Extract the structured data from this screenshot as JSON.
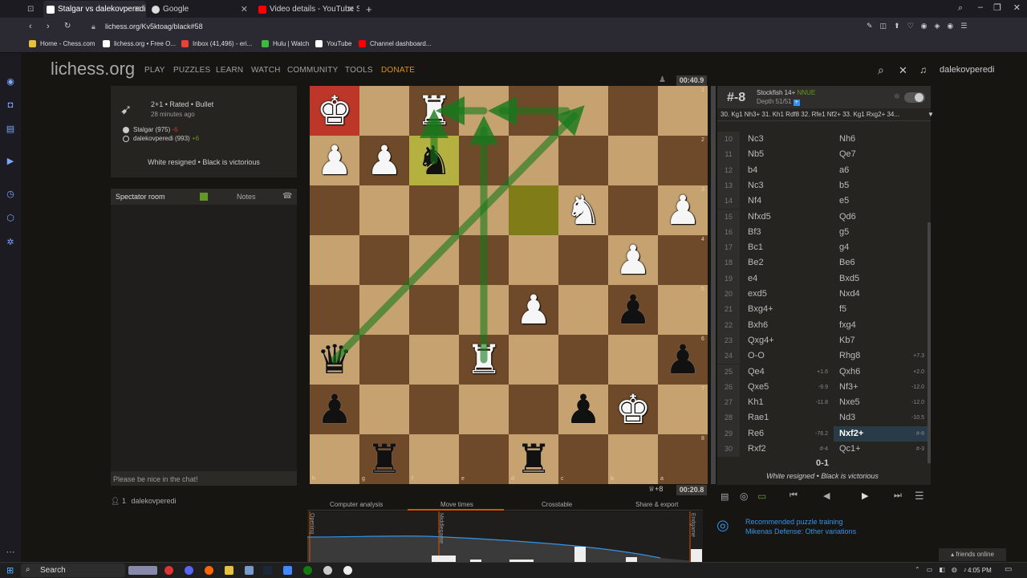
{
  "browser": {
    "tabs": [
      {
        "label": "Stalgar vs dalekovperedi: M",
        "active": true
      },
      {
        "label": "Google",
        "active": false
      },
      {
        "label": "Video details - YouTube Stu",
        "active": false
      }
    ],
    "new_tab": "+",
    "url": "lichess.org/Kv5ktoag/black#58",
    "bookmarks": [
      "Home - Chess.com",
      "lichess.org • Free O...",
      "Inbox (41,496) - eri...",
      "Hulu | Watch",
      "YouTube",
      "Channel dashboard..."
    ]
  },
  "lichess": {
    "logo": "lichess.org",
    "nav": [
      "PLAY",
      "PUZZLES",
      "LEARN",
      "WATCH",
      "COMMUNITY",
      "TOOLS",
      "DONATE"
    ],
    "username": "dalekovperedi"
  },
  "game": {
    "type": "2+1 • Rated • Bullet",
    "when": "28 minutes ago",
    "white_player": "Stalgar (975)",
    "white_diff": "-6",
    "black_player": "dalekovperedi (993)",
    "black_diff": "+6",
    "result": "White resigned • Black is victorious"
  },
  "chat": {
    "tab_room": "Spectator room",
    "tab_notes": "Notes",
    "placeholder": "Please be nice in the chat!",
    "spectators": "1",
    "spectator_name": "dalekovperedi"
  },
  "clocks": {
    "top": "00:40.9",
    "bottom": "00:20.8",
    "bottom_material": "+8"
  },
  "board": {
    "files_bottom": [
      "h",
      "g",
      "f",
      "e",
      "d",
      "c",
      "b",
      "a"
    ],
    "ranks_right": [
      "1",
      "2",
      "3",
      "4",
      "5",
      "6",
      "7",
      "8"
    ]
  },
  "engine": {
    "eval": "#-8",
    "name": "Stockfish 14+",
    "tag": "NNUE",
    "depth": "Depth 51/51",
    "pv": "30. Kg1 Nh3+ 31. Kh1 Rdf8 32. Rfe1 Nf2+ 33. Kg1 Rxg2+ 34..."
  },
  "moves": [
    {
      "n": "10",
      "w": "Nc3",
      "b": "Nh6",
      "ew": "",
      "eb": ""
    },
    {
      "n": "11",
      "w": "Nb5",
      "b": "Qe7",
      "ew": "",
      "eb": ""
    },
    {
      "n": "12",
      "w": "b4",
      "b": "a6",
      "ew": "",
      "eb": ""
    },
    {
      "n": "13",
      "w": "Nc3",
      "b": "b5",
      "ew": "",
      "eb": ""
    },
    {
      "n": "14",
      "w": "Nf4",
      "b": "e5",
      "ew": "",
      "eb": ""
    },
    {
      "n": "15",
      "w": "Nfxd5",
      "b": "Qd6",
      "ew": "",
      "eb": ""
    },
    {
      "n": "16",
      "w": "Bf3",
      "b": "g5",
      "ew": "",
      "eb": ""
    },
    {
      "n": "17",
      "w": "Bc1",
      "b": "g4",
      "ew": "",
      "eb": ""
    },
    {
      "n": "18",
      "w": "Be2",
      "b": "Be6",
      "ew": "",
      "eb": ""
    },
    {
      "n": "19",
      "w": "e4",
      "b": "Bxd5",
      "ew": "",
      "eb": ""
    },
    {
      "n": "20",
      "w": "exd5",
      "b": "Nxd4",
      "ew": "",
      "eb": ""
    },
    {
      "n": "21",
      "w": "Bxg4+",
      "b": "f5",
      "ew": "",
      "eb": ""
    },
    {
      "n": "22",
      "w": "Bxh6",
      "b": "fxg4",
      "ew": "",
      "eb": ""
    },
    {
      "n": "23",
      "w": "Qxg4+",
      "b": "Kb7",
      "ew": "",
      "eb": ""
    },
    {
      "n": "24",
      "w": "O-O",
      "b": "Rhg8",
      "ew": "",
      "eb": "+7.3"
    },
    {
      "n": "25",
      "w": "Qe4",
      "b": "Qxh6",
      "ew": "+1.6",
      "eb": "+2.0"
    },
    {
      "n": "26",
      "w": "Qxe5",
      "b": "Nf3+",
      "ew": "-9.9",
      "eb": "-12.0"
    },
    {
      "n": "27",
      "w": "Kh1",
      "b": "Nxe5",
      "ew": "-11.8",
      "eb": "-12.0"
    },
    {
      "n": "28",
      "w": "Rae1",
      "b": "Nd3",
      "ew": "",
      "eb": "-10.5"
    },
    {
      "n": "29",
      "w": "Re6",
      "b": "Nxf2+",
      "ew": "-76.2",
      "eb": "#-8"
    },
    {
      "n": "30",
      "w": "Rxf2",
      "b": "Qc1+",
      "ew": "#-4",
      "eb": "#-3"
    }
  ],
  "final": {
    "score": "0-1",
    "text": "White resigned • Black is victorious"
  },
  "analysis_tabs": [
    "Computer analysis",
    "Move times",
    "Crosstable",
    "Share & export"
  ],
  "chart_labels": {
    "opening": "Opening",
    "middlegame": "Middlegame",
    "endgame": "Endgame"
  },
  "puzzle": {
    "title": "Recommended puzzle training",
    "subtitle": "Mikenas Defense: Other variations"
  },
  "friends": "friends online",
  "taskbar": {
    "search": "Search",
    "time": "4:05 PM"
  },
  "colors": {
    "accent": "#629924",
    "donate": "#d59120",
    "bg": "#161512",
    "panel": "#262421"
  }
}
